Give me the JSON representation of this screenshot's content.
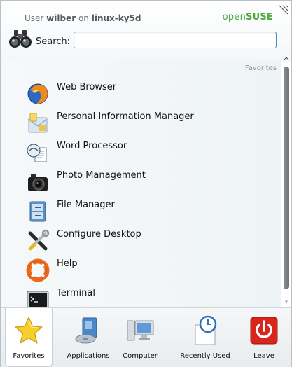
{
  "header": {
    "user_prefix": "User ",
    "user_name": "wilber",
    "host_prefix": " on ",
    "host_name": "linux-ky5d",
    "brand_open": "open",
    "brand_suse": "SUSE"
  },
  "search": {
    "label": "Search:",
    "value": "",
    "placeholder": ""
  },
  "favorites": {
    "section_title": "Favorites",
    "items": [
      {
        "label": "Web Browser",
        "icon": "web-browser-icon"
      },
      {
        "label": "Personal Information Manager",
        "icon": "pim-icon"
      },
      {
        "label": "Word Processor",
        "icon": "word-processor-icon"
      },
      {
        "label": "Photo Management",
        "icon": "camera-icon"
      },
      {
        "label": "File Manager",
        "icon": "file-manager-icon"
      },
      {
        "label": "Configure Desktop",
        "icon": "tools-icon"
      },
      {
        "label": "Help",
        "icon": "lifebuoy-icon"
      },
      {
        "label": "Terminal",
        "icon": "terminal-icon"
      }
    ]
  },
  "tabs": [
    {
      "label": "Favorites",
      "icon": "star-icon",
      "active": true
    },
    {
      "label": "Applications",
      "icon": "applications-icon",
      "active": false
    },
    {
      "label": "Computer",
      "icon": "computer-icon",
      "active": false
    },
    {
      "label": "Recently Used",
      "icon": "clock-icon",
      "active": false
    },
    {
      "label": "Leave",
      "icon": "power-icon",
      "active": false
    }
  ],
  "colors": {
    "brand_green": "#51a83f",
    "search_border": "#4a90c8",
    "leave_red": "#d9261c"
  }
}
